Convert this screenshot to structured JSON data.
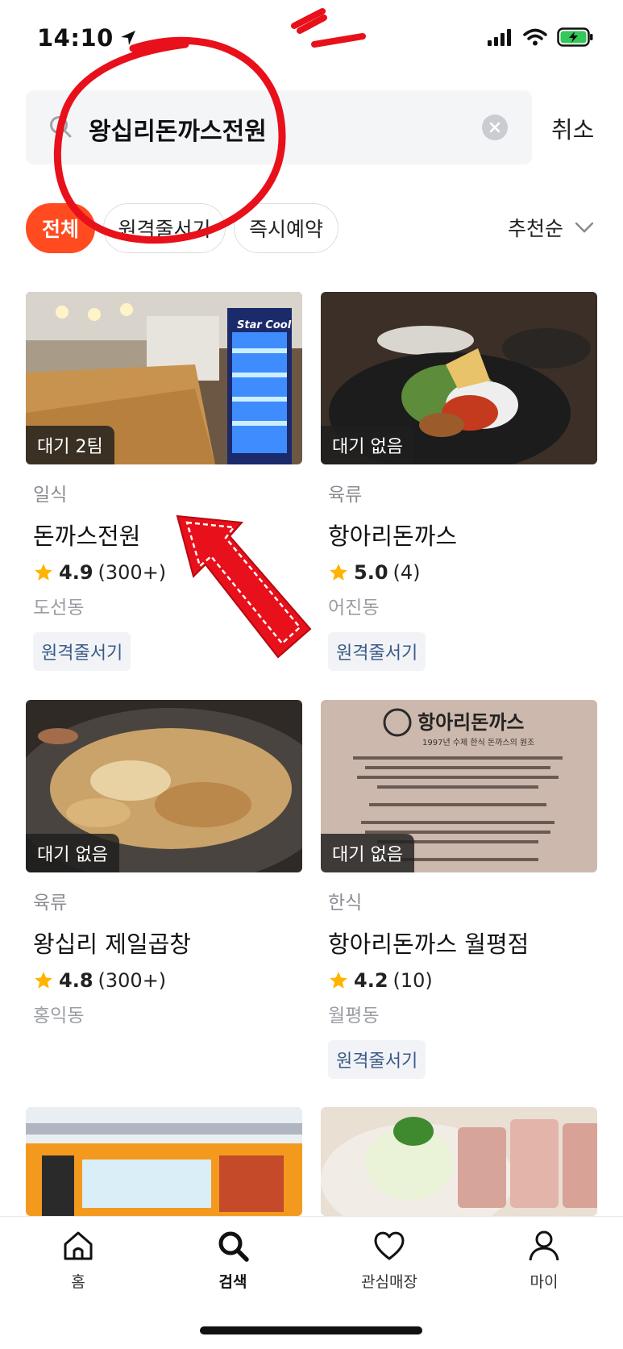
{
  "status_bar": {
    "time": "14:10"
  },
  "search": {
    "query": "왕십리돈까스전원",
    "cancel_label": "취소"
  },
  "filters": [
    {
      "label": "전체",
      "active": true
    },
    {
      "label": "원격줄서기",
      "active": false
    },
    {
      "label": "즉시예약",
      "active": false
    }
  ],
  "sort": {
    "label": "추천순"
  },
  "restaurants": [
    {
      "wait": "대기 2팀",
      "category": "일식",
      "name": "돈까스전원",
      "rating": "4.9",
      "reviews": "(300+)",
      "area": "도선동",
      "tag": "원격줄서기"
    },
    {
      "wait": "대기 없음",
      "category": "육류",
      "name": "항아리돈까스",
      "rating": "5.0",
      "reviews": "(4)",
      "area": "어진동",
      "tag": "원격줄서기"
    },
    {
      "wait": "대기 없음",
      "category": "육류",
      "name": "왕십리 제일곱창",
      "rating": "4.8",
      "reviews": "(300+)",
      "area": "홍익동",
      "tag": ""
    },
    {
      "wait": "대기 없음",
      "category": "한식",
      "name": "항아리돈까스 월평점",
      "rating": "4.2",
      "reviews": "(10)",
      "area": "월평동",
      "tag": "원격줄서기"
    }
  ],
  "photo_text": {
    "fridge_brand": "Star Cool",
    "sign_title": "항아리돈까스",
    "sign_subtitle": "1997년 수제 한식 돈까스의 원조"
  },
  "bottom_nav": [
    {
      "label": "홈",
      "icon": "home-icon"
    },
    {
      "label": "검색",
      "icon": "search-icon"
    },
    {
      "label": "관심매장",
      "icon": "heart-icon"
    },
    {
      "label": "마이",
      "icon": "person-icon"
    }
  ],
  "colors": {
    "accent": "#ff4b1f",
    "tag_text": "#3a5a85",
    "annotation_red": "#e8101a"
  }
}
